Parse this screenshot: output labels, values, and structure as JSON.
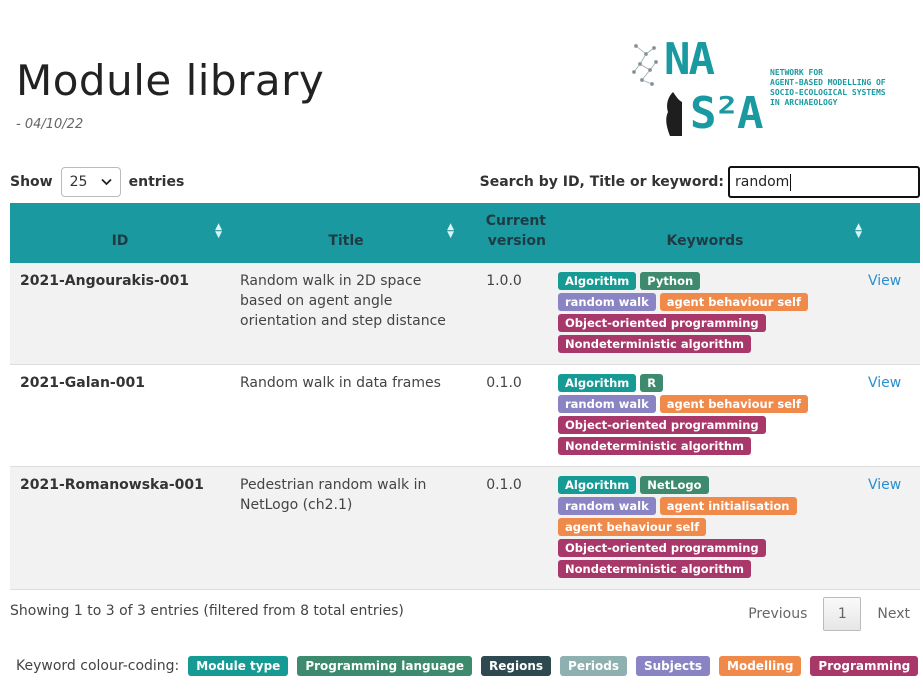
{
  "header": {
    "title": "Module library",
    "date": "- 04/10/22"
  },
  "logo": {
    "line1": "NA",
    "line2": "S²A",
    "tagline": [
      "NETWORK FOR",
      "AGENT-BASED MODELLING OF",
      "SOCIO-ECOLOGICAL SYSTEMS",
      "IN ARCHAEOLOGY"
    ]
  },
  "controls": {
    "show_label": "Show",
    "entries_value": "25",
    "entries_label": "entries",
    "search_label": "Search by ID, Title or keyword:",
    "search_value": "random"
  },
  "table": {
    "headers": {
      "id": "ID",
      "title": "Title",
      "version": [
        "Current",
        "version"
      ],
      "keywords": "Keywords"
    },
    "sort_glyph": "▲\n▼",
    "rows": [
      {
        "id": "2021-Angourakis-001",
        "title": "Random walk in 2D space based on agent angle orientation and step distance",
        "version": "1.0.0",
        "action": "View"
      },
      {
        "id": "2021-Galan-001",
        "title": "Random walk in data frames",
        "version": "0.1.0",
        "action": "View"
      },
      {
        "id": "2021-Romanowska-001",
        "title": "Pedestrian random walk in NetLogo (ch2.1)",
        "version": "0.1.0",
        "action": "View"
      }
    ],
    "keywords": [
      [
        [
          {
            "label": "Algorithm",
            "color": "#159a94"
          },
          {
            "label": "Python",
            "color": "#3d8a6e"
          }
        ],
        [
          {
            "label": "random walk",
            "color": "#8b84c4"
          },
          {
            "label": "agent behaviour self",
            "color": "#f08a4b"
          }
        ],
        [
          {
            "label": "Object-oriented programming",
            "color": "#a8386a"
          }
        ],
        [
          {
            "label": "Nondeterministic algorithm",
            "color": "#a8386a"
          }
        ]
      ],
      [
        [
          {
            "label": "Algorithm",
            "color": "#159a94"
          },
          {
            "label": "R",
            "color": "#3d8a6e"
          }
        ],
        [
          {
            "label": "random walk",
            "color": "#8b84c4"
          },
          {
            "label": "agent behaviour self",
            "color": "#f08a4b"
          }
        ],
        [
          {
            "label": "Object-oriented programming",
            "color": "#a8386a"
          }
        ],
        [
          {
            "label": "Nondeterministic algorithm",
            "color": "#a8386a"
          }
        ]
      ],
      [
        [
          {
            "label": "Algorithm",
            "color": "#159a94"
          },
          {
            "label": "NetLogo",
            "color": "#3d8a6e"
          }
        ],
        [
          {
            "label": "random walk",
            "color": "#8b84c4"
          },
          {
            "label": "agent initialisation",
            "color": "#f08a4b"
          }
        ],
        [
          {
            "label": "agent behaviour self",
            "color": "#f08a4b"
          }
        ],
        [
          {
            "label": "Object-oriented programming",
            "color": "#a8386a"
          }
        ],
        [
          {
            "label": "Nondeterministic algorithm",
            "color": "#a8386a"
          }
        ]
      ]
    ]
  },
  "footer": {
    "info": "Showing 1 to 3 of 3 entries (filtered from 8 total entries)",
    "previous": "Previous",
    "current_page": "1",
    "next": "Next"
  },
  "legend": {
    "label": "Keyword colour-coding:",
    "items": [
      {
        "label": "Module type",
        "color": "#159a94"
      },
      {
        "label": "Programming language",
        "color": "#3d8a6e"
      },
      {
        "label": "Regions",
        "color": "#2e4a50"
      },
      {
        "label": "Periods",
        "color": "#8fb0b0"
      },
      {
        "label": "Subjects",
        "color": "#8b84c4"
      },
      {
        "label": "Modelling",
        "color": "#f08a4b"
      },
      {
        "label": "Programming",
        "color": "#a8386a"
      }
    ]
  }
}
